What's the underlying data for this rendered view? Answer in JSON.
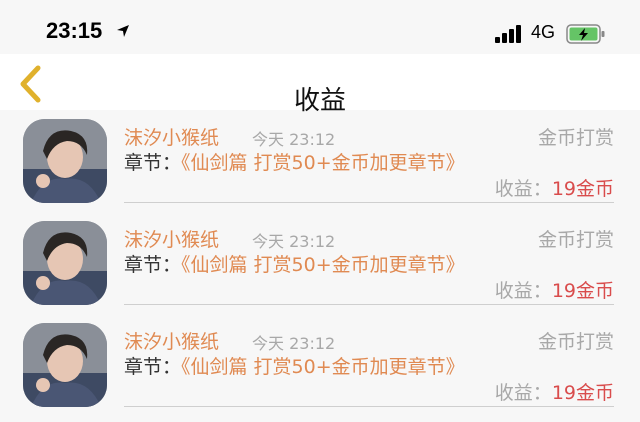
{
  "status_bar": {
    "time": "23:15",
    "network": "4G",
    "battery_color": "#65c466",
    "icons": [
      "location-arrow-icon",
      "signal-bars-icon",
      "battery-charging-icon"
    ]
  },
  "nav": {
    "title": "收益",
    "back_icon": "chevron-left-icon",
    "back_color": "#e0b12c"
  },
  "items": [
    {
      "name": "沫汐小猴纸",
      "datetime": "今天 23:12",
      "type": "金币打赏",
      "chapter_label": "章节：",
      "chapter_title": "《仙剑篇 打赏50+金币加更章节》",
      "earn_label": "收益：",
      "earn_value": "19金币"
    },
    {
      "name": "沫汐小猴纸",
      "datetime": "今天 23:12",
      "type": "金币打赏",
      "chapter_label": "章节：",
      "chapter_title": "《仙剑篇 打赏50+金币加更章节》",
      "earn_label": "收益：",
      "earn_value": "19金币"
    },
    {
      "name": "沫汐小猴纸",
      "datetime": "今天 23:12",
      "type": "金币打赏",
      "chapter_label": "章节：",
      "chapter_title": "《仙剑篇 打赏50+金币加更章节》",
      "earn_label": "收益：",
      "earn_value": "19金币"
    }
  ]
}
